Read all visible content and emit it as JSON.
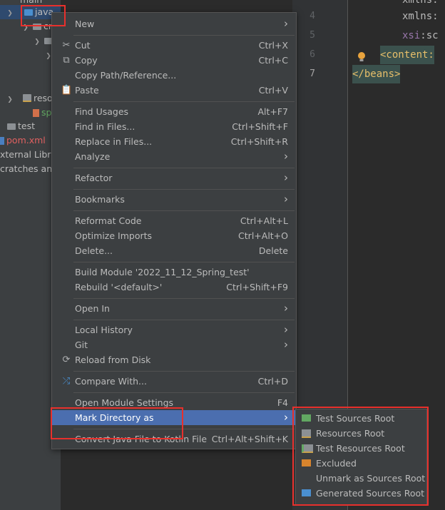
{
  "tree": {
    "rows": [
      {
        "label": "main"
      },
      {
        "label": "java"
      },
      {
        "label": "cr"
      },
      {
        "label": ""
      },
      {
        "label": ""
      },
      {
        "label": "reso"
      },
      {
        "label": "sp"
      },
      {
        "label": "test"
      },
      {
        "label": "pom.xml"
      },
      {
        "label": "xternal Libra"
      },
      {
        "label": "cratches and"
      }
    ]
  },
  "editor": {
    "line_numbers": [
      "4",
      "5",
      "6",
      "7"
    ],
    "lines": [
      {
        "attr": "xmlns:",
        "ns": ""
      },
      {
        "attr": "xmlns:",
        "ns": ""
      },
      {
        "attr": "xsi",
        "ns": ":sc"
      },
      {
        "tag": "<content:"
      },
      {
        "tag": "</beans>"
      }
    ]
  },
  "menu": {
    "new": {
      "label": "New"
    },
    "cut": {
      "label": "Cut",
      "shortcut": "Ctrl+X"
    },
    "copy": {
      "label": "Copy",
      "shortcut": "Ctrl+C"
    },
    "copy_path": {
      "label": "Copy Path/Reference..."
    },
    "paste": {
      "label": "Paste",
      "shortcut": "Ctrl+V"
    },
    "find_usages": {
      "label": "Find Usages",
      "shortcut": "Alt+F7"
    },
    "find_in_files": {
      "label": "Find in Files...",
      "shortcut": "Ctrl+Shift+F"
    },
    "replace_in_files": {
      "label": "Replace in Files...",
      "shortcut": "Ctrl+Shift+R"
    },
    "analyze": {
      "label": "Analyze"
    },
    "refactor": {
      "label": "Refactor"
    },
    "bookmarks": {
      "label": "Bookmarks"
    },
    "reformat_code": {
      "label": "Reformat Code",
      "shortcut": "Ctrl+Alt+L"
    },
    "optimize_imports": {
      "label": "Optimize Imports",
      "shortcut": "Ctrl+Alt+O"
    },
    "delete": {
      "label": "Delete...",
      "shortcut": "Delete"
    },
    "build_module": {
      "label": "Build Module '2022_11_12_Spring_test'"
    },
    "rebuild": {
      "label": "Rebuild '<default>'",
      "shortcut": "Ctrl+Shift+F9"
    },
    "open_in": {
      "label": "Open In"
    },
    "local_history": {
      "label": "Local History"
    },
    "git": {
      "label": "Git"
    },
    "reload_from_disk": {
      "label": "Reload from Disk"
    },
    "compare_with": {
      "label": "Compare With...",
      "shortcut": "Ctrl+D"
    },
    "open_module_settings": {
      "label": "Open Module Settings",
      "shortcut": "F4"
    },
    "mark_directory_as": {
      "label": "Mark Directory as"
    },
    "convert_java": {
      "label": "Convert Java File to Kotlin File",
      "shortcut": "Ctrl+Alt+Shift+K"
    }
  },
  "submenu": {
    "items": [
      {
        "label": "Test Sources Root",
        "icon": "test-sources-folder-icon",
        "color": "#62a862"
      },
      {
        "label": "Resources Root",
        "icon": "resources-folder-icon",
        "color": "#8c9094"
      },
      {
        "label": "Test Resources Root",
        "icon": "test-resources-folder-icon",
        "color": "#8c9094"
      },
      {
        "label": "Excluded",
        "icon": "excluded-folder-icon",
        "color": "#d7842d"
      },
      {
        "label": "Unmark as Sources Root",
        "icon": "",
        "color": ""
      },
      {
        "label": "Generated Sources Root",
        "icon": "generated-sources-folder-icon",
        "color": "#4a8fcf"
      }
    ]
  },
  "colors": {
    "highlight": "#4b6eaf",
    "annotation": "#e8302c"
  }
}
